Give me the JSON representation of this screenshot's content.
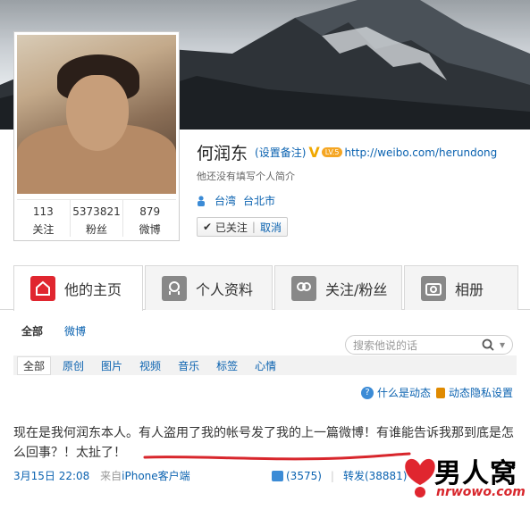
{
  "profile": {
    "name": "何润东",
    "remark": "(设置备注)",
    "verified_icon": "V",
    "level_badge": "LV.5",
    "url": "http://weibo.com/herundong",
    "intro": "他还没有填写个人简介",
    "location_region": "台湾",
    "location_city": "台北市",
    "follow_status": "已关注",
    "follow_cancel": "取消"
  },
  "stats": [
    {
      "value": "113",
      "label": "关注"
    },
    {
      "value": "5373821",
      "label": "粉丝"
    },
    {
      "value": "879",
      "label": "微博"
    }
  ],
  "tabs": [
    {
      "label": "他的主页",
      "icon": "home-icon"
    },
    {
      "label": "个人资料",
      "icon": "profile-icon"
    },
    {
      "label": "关注/粉丝",
      "icon": "follow-icon"
    },
    {
      "label": "相册",
      "icon": "camera-icon"
    }
  ],
  "subnav": {
    "all": "全部",
    "weibo": "微博"
  },
  "search": {
    "placeholder": "搜索他说的话"
  },
  "filters": [
    "全部",
    "原创",
    "图片",
    "视频",
    "音乐",
    "标签",
    "心情"
  ],
  "help": {
    "what_is_feed": "什么是动态",
    "privacy": "动态隐私设置"
  },
  "post": {
    "text": "现在是我何润东本人。有人盗用了我的帐号发了我的上一篇微博！有谁能告诉我那到底是怎么回事？！太扯了！",
    "time": "3月15日 22:08",
    "source_prefix": "来自",
    "source": "iPhone客户端",
    "likes": "(3575)",
    "repost": "转发(38881)"
  },
  "watermark": {
    "title": "男人窝",
    "domain": "nrwowo.com"
  },
  "colors": {
    "link": "#0a62b0",
    "accent": "#e0262f",
    "annotation_line": "#d8262c"
  }
}
